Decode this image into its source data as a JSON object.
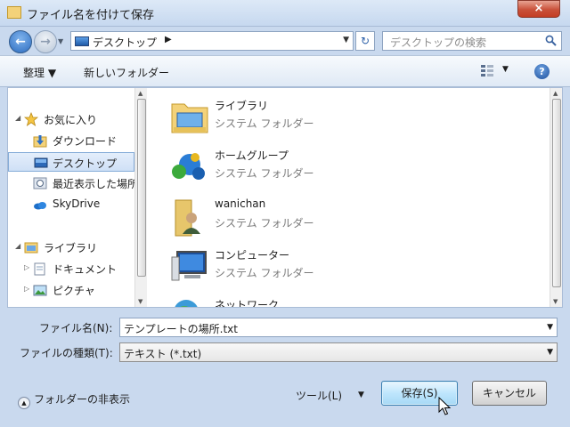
{
  "window": {
    "title": "ファイル名を付けて保存",
    "close": "×"
  },
  "nav": {
    "back": "←",
    "forward": "→",
    "history": "▼",
    "refresh": "↻"
  },
  "address": {
    "location": "デスクトップ",
    "chevron": "▶",
    "dropdown": "▼"
  },
  "search": {
    "placeholder": "デスクトップの検索"
  },
  "toolbar": {
    "organize": "整理 ▼",
    "new_folder": "新しいフォルダー",
    "view_dropdown": "▼",
    "help": "?"
  },
  "nav_pane": {
    "items": [
      {
        "label": "お気に入り",
        "icon": "star-icon",
        "arrow": "◢"
      },
      {
        "label": "ダウンロード",
        "icon": "download-icon"
      },
      {
        "label": "デスクトップ",
        "icon": "desktop-icon",
        "selected": true
      },
      {
        "label": "最近表示した場所",
        "icon": "recent-places-icon"
      },
      {
        "label": "SkyDrive",
        "icon": "skydrive-icon"
      },
      {
        "label": "ライブラリ",
        "icon": "library-icon",
        "arrow": "◢"
      },
      {
        "label": "ドキュメント",
        "icon": "documents-icon",
        "arrow": "▷"
      },
      {
        "label": "ピクチャ",
        "icon": "pictures-icon",
        "arrow": "▷"
      }
    ]
  },
  "files": [
    {
      "name": "ライブラリ",
      "type": "システム フォルダー",
      "icon": "library-folder-icon"
    },
    {
      "name": "ホームグループ",
      "type": "システム フォルダー",
      "icon": "homegroup-icon"
    },
    {
      "name": "wanichan",
      "type": "システム フォルダー",
      "icon": "user-folder-icon"
    },
    {
      "name": "コンピューター",
      "type": "システム フォルダー",
      "icon": "computer-icon"
    },
    {
      "name": "ネットワーク",
      "type": "",
      "icon": "network-icon"
    }
  ],
  "form": {
    "filename_label": "ファイル名(N):",
    "filename_value": "テンプレートの場所.txt",
    "filetype_label": "ファイルの種類(T):",
    "filetype_value": "テキスト (*.txt)",
    "dropdown": "▼"
  },
  "footer": {
    "hide_folders": "フォルダーの非表示",
    "tools": "ツール(L)",
    "tools_dropdown": "▼",
    "save": "保存(S)",
    "cancel": "キャンセル"
  }
}
